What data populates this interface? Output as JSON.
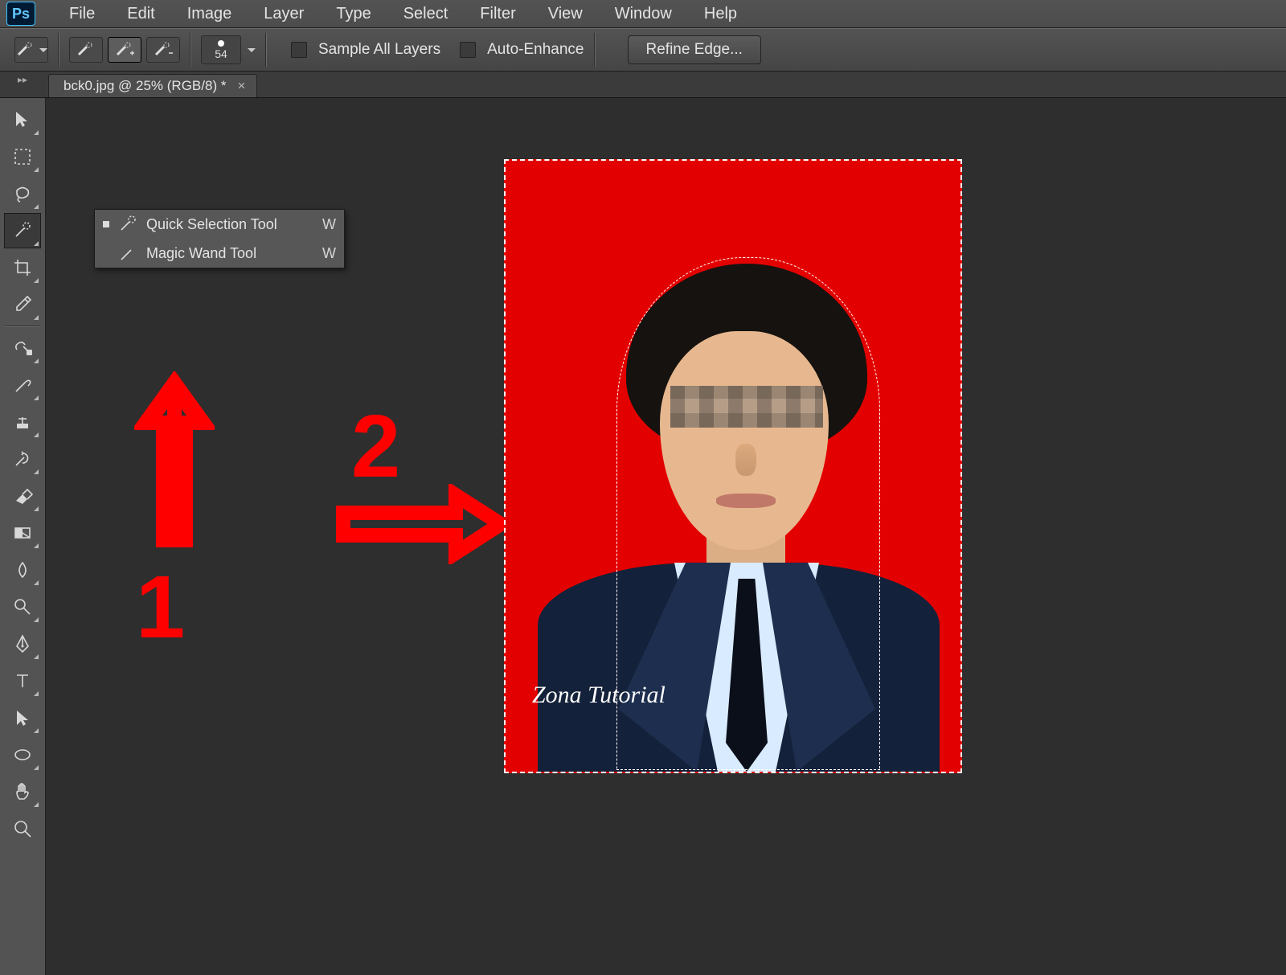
{
  "app": {
    "logo": "Ps"
  },
  "menu": [
    "File",
    "Edit",
    "Image",
    "Layer",
    "Type",
    "Select",
    "Filter",
    "View",
    "Window",
    "Help"
  ],
  "options": {
    "brush_size": "54",
    "sample_all_layers": "Sample All Layers",
    "auto_enhance": "Auto-Enhance",
    "refine_edge": "Refine Edge..."
  },
  "tab": {
    "title": "bck0.jpg @ 25% (RGB/8) *",
    "close": "×"
  },
  "toolbox": [
    {
      "name": "move-tool",
      "tri": true
    },
    {
      "name": "marquee-tool",
      "tri": true
    },
    {
      "name": "lasso-tool",
      "tri": true
    },
    {
      "name": "quick-selection-tool",
      "tri": true,
      "active": true
    },
    {
      "name": "crop-tool",
      "tri": true
    },
    {
      "name": "eyedropper-tool",
      "tri": true
    },
    {
      "name": "healing-brush-tool",
      "tri": true
    },
    {
      "name": "brush-tool",
      "tri": true
    },
    {
      "name": "clone-stamp-tool",
      "tri": true
    },
    {
      "name": "history-brush-tool",
      "tri": true
    },
    {
      "name": "eraser-tool",
      "tri": true
    },
    {
      "name": "gradient-tool",
      "tri": true
    },
    {
      "name": "blur-tool",
      "tri": true
    },
    {
      "name": "dodge-tool",
      "tri": true
    },
    {
      "name": "pen-tool",
      "tri": true
    },
    {
      "name": "type-tool",
      "tri": true
    },
    {
      "name": "path-selection-tool",
      "tri": true
    },
    {
      "name": "ellipse-tool",
      "tri": true
    },
    {
      "name": "hand-tool",
      "tri": true
    },
    {
      "name": "zoom-tool",
      "tri": false
    }
  ],
  "flyout": {
    "items": [
      {
        "label": "Quick Selection Tool",
        "key": "W",
        "selected": true,
        "icon": "quick-selection-icon"
      },
      {
        "label": "Magic Wand Tool",
        "key": "W",
        "selected": false,
        "icon": "magic-wand-icon"
      }
    ]
  },
  "annotations": {
    "one": "1",
    "two": "2"
  },
  "document": {
    "watermark": "Zona Tutorial",
    "bg_color": "#e30000"
  }
}
